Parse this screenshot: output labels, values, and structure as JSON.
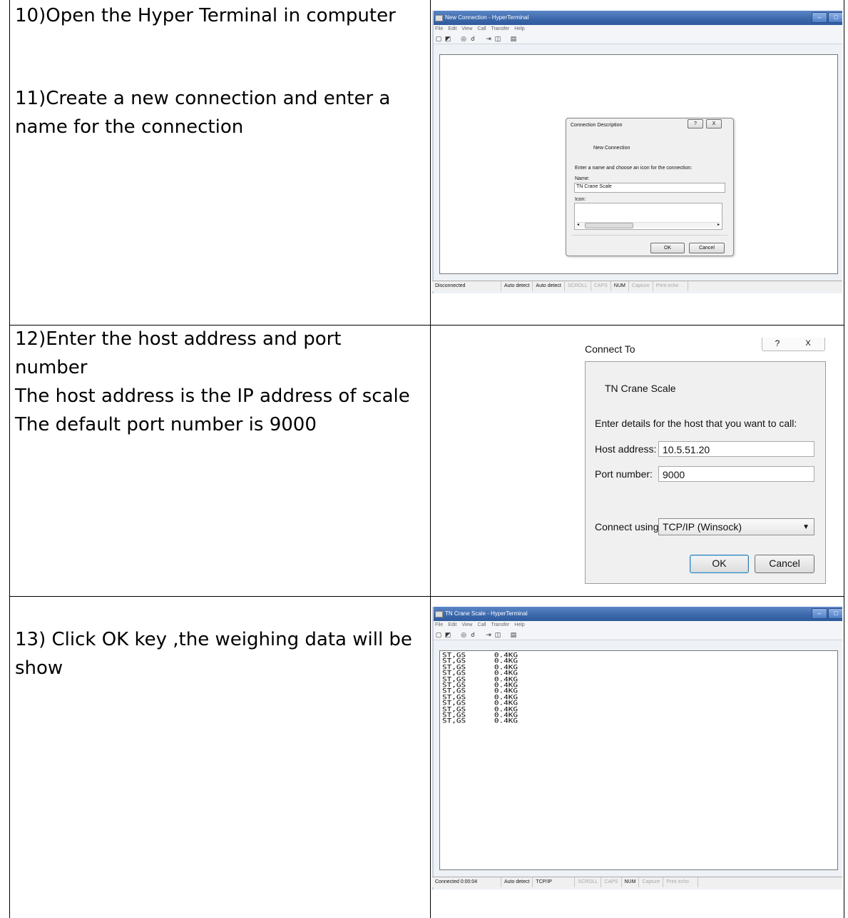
{
  "steps": [
    {
      "lines": [
        "10)Open the Hyper Terminal in computer"
      ]
    },
    {
      "lines": [
        "11)Create a new connection and enter a",
        "name for the connection"
      ]
    },
    {
      "lines": [
        "12)Enter the host address and port",
        "number",
        "The host address is the IP address of scale",
        "The default port number is 9000"
      ]
    },
    {
      "lines": [
        "13) Click OK key ,the weighing data will be",
        "show"
      ]
    }
  ],
  "window1": {
    "title": "New Connection - HyperTerminal",
    "menu": [
      "File",
      "Edit",
      "View",
      "Call",
      "Transfer",
      "Help"
    ],
    "status": [
      "Disconnected",
      "Auto detect",
      "Auto detect",
      "SCROLL",
      "CAPS",
      "NUM",
      "Capture",
      "Print echo"
    ],
    "dialog": {
      "title": "Connection Description",
      "help_glyph": "?",
      "close_glyph": "X",
      "connection_name": "New Connection",
      "instruction": "Enter a name and choose an icon for the connection:",
      "name_label": "Name:",
      "name_value": "TN Crane Scale",
      "icon_label": "Icon:",
      "ok_label": "OK",
      "cancel_label": "Cancel"
    }
  },
  "connect_to": {
    "title": "Connect To",
    "help_glyph": "?",
    "close_glyph": "X",
    "connection_name": "TN Crane Scale",
    "instruction": "Enter details for the host that you want to call:",
    "host_label": "Host address:",
    "host_value": "10.5.51.20",
    "port_label": "Port number:",
    "port_value": "9000",
    "connect_label": "Connect using:",
    "connect_value": "TCP/IP (Winsock)",
    "ok_label": "OK",
    "cancel_label": "Cancel"
  },
  "window2": {
    "title": "TN Crane Scale - HyperTerminal",
    "menu": [
      "File",
      "Edit",
      "View",
      "Call",
      "Transfer",
      "Help"
    ],
    "terminal_lines": [
      "ST,GS      0.4KG",
      "ST,GS      0.4KG",
      "ST,GS      0.4KG",
      "ST,GS      0.4KG",
      "ST,GS      0.4KG",
      "ST,GS      0.4KG",
      "ST,GS      0.4KG",
      "ST,GS      0.4KG",
      "ST,GS      0.4KG",
      "ST,GS      0.4KG",
      "ST,GS      0.4KG",
      "ST,GS      0.4KG"
    ],
    "status": [
      "Connected 0:00:04",
      "Auto detect",
      "TCP/IP",
      "SCROLL",
      "CAPS",
      "NUM",
      "Capture",
      "Print echo"
    ]
  }
}
